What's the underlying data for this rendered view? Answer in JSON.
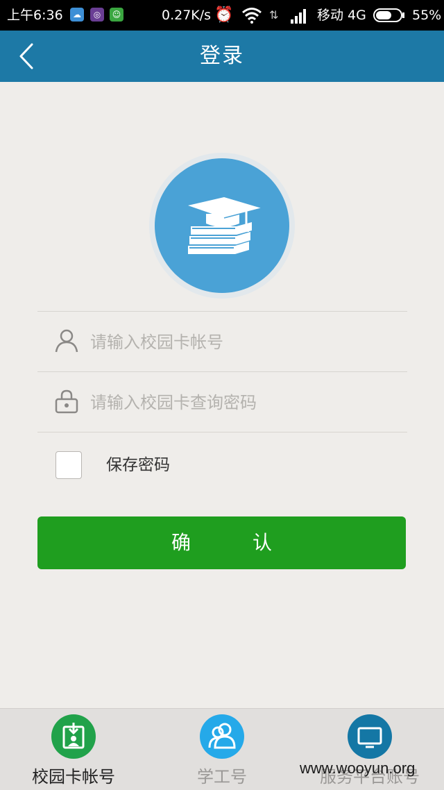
{
  "status_bar": {
    "time": "上午6:36",
    "speed": "0.27K/s",
    "carrier": "移动 4G",
    "battery": "55%",
    "icons": [
      "cloud-app-icon",
      "camera-app-icon",
      "cat-app-icon",
      "alarm-icon",
      "wifi-icon",
      "data-arrows-icon",
      "signal-icon",
      "battery-icon"
    ]
  },
  "header": {
    "title": "登录"
  },
  "form": {
    "account_placeholder": "请输入校园卡帐号",
    "password_placeholder": "请输入校园卡查询密码",
    "save_password_label": "保存密码",
    "confirm_label": "确 认"
  },
  "bottom_nav": {
    "items": [
      {
        "label": "校园卡帐号",
        "icon": "id-badge-icon"
      },
      {
        "label": "学工号",
        "icon": "users-icon"
      },
      {
        "label": "服务平台账号",
        "icon": "monitor-icon"
      }
    ]
  },
  "watermark": "www.wooyun.org",
  "colors": {
    "header": "#1d79a6",
    "confirm_button": "#1f9e1f",
    "logo": "#4aa2d6"
  }
}
